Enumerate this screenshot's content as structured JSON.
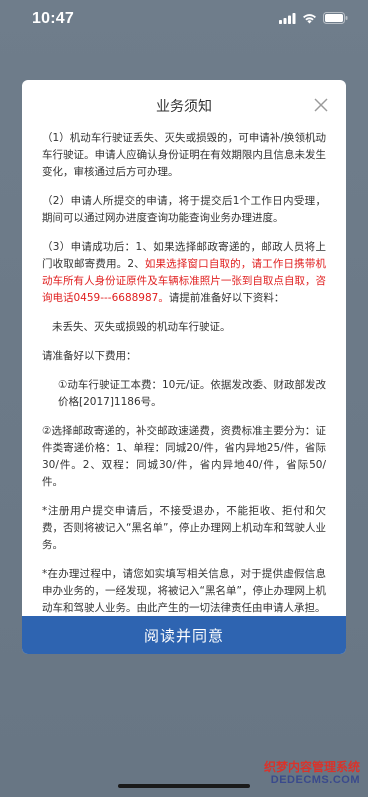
{
  "status_bar": {
    "time": "10:47"
  },
  "dialog": {
    "title": "业务须知",
    "paragraphs": {
      "p1": "（1）机动车行驶证丢失、灭失或损毁的，可申请补/换领机动车行驶证。申请人应确认身份证明在有效期限内且信息未发生变化，审核通过后方可办理。",
      "p2": "（2）申请人所提交的申请，将于提交后1个工作日内受理，期间可以通过网办进度查询功能查询业务办理进度。",
      "p3_a": "（3）申请成功后：1、如果选择邮政寄递的，邮政人员将上门收取邮寄费用。2、",
      "p3_red": "如果选择窗口自取的，请工作日携带机动车所有人身份证原件及车辆标准照片一张到自取点自取，咨询电话0459---6688987。",
      "p3_b": "请提前准备好以下资料：",
      "p4": "未丢失、灭失或损毁的机动车行驶证。",
      "p5": "请准备好以下费用：",
      "p6": "①动车行驶证工本费：10元/证。依据发改委、财政部发改价格[2017]1186号。",
      "p7": "②选择邮政寄递的，补交邮政速递费，资费标准主要分为：证件类寄递价格：1、单程：同城20/件，省内异地25/件，省际30/件。2、双程：同城30/件，省内异地40/件，省际50/件。",
      "p8": "*注册用户提交申请后，不接受退办，不能拒收、拒付和欠费，否则将被记入“黑名单”，停止办理网上机动车和驾驶人业务。",
      "p9": "*在办理过程中，请您如实填写相关信息，对于提供虚假信息申办业务的，一经发现，将被记入“黑名单”，停止办理网上机动车和驾驶人业务。由此产生的一切法律责任由申请人承担。"
    },
    "agree_label": "阅读并同意"
  },
  "watermark": {
    "line1": "织梦内容管理系统",
    "line2": "DEDECMS.COM"
  },
  "colors": {
    "accent": "#2e64b1",
    "warning_text": "#e02020",
    "overlay": "#6f7d8b"
  }
}
